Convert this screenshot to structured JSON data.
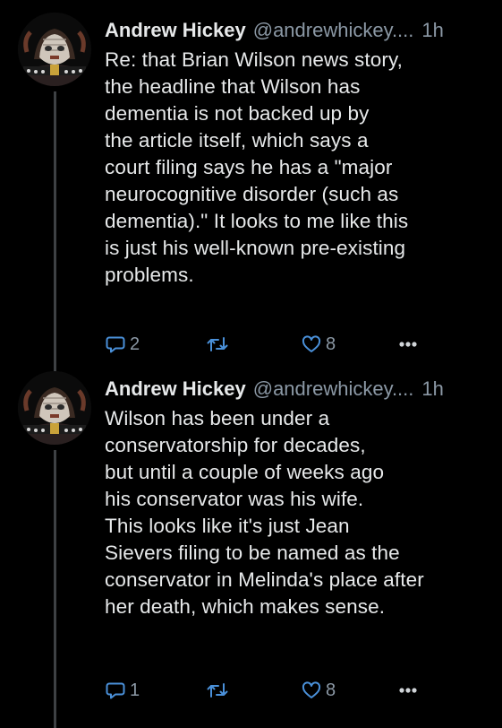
{
  "tweets": [
    {
      "author_name": "Andrew Hickey",
      "author_handle": "@andrewhickey....",
      "time": "1h",
      "text": "Re: that Brian Wilson news story,\nthe headline that Wilson has\ndementia is not backed up by\nthe article itself, which says a\ncourt filing says he has a \"major\nneurocognitive disorder (such as\ndementia).\" It looks to me like this\nis just his well-known pre-existing\nproblems.",
      "reply_count": "2",
      "retweet_count": "",
      "like_count": "8",
      "icons": [
        "avatar",
        "reply-icon",
        "retweet-icon",
        "like-icon",
        "more-icon"
      ]
    },
    {
      "author_name": "Andrew Hickey",
      "author_handle": "@andrewhickey....",
      "time": "1h",
      "text": "Wilson has been under a\nconservatorship for decades,\nbut until a couple of weeks ago\nhis conservator was his wife.\nThis looks like it's just Jean\nSievers filing to be named as the\nconservator in Melinda's place after\nher death, which makes sense.",
      "reply_count": "1",
      "retweet_count": "",
      "like_count": "8",
      "icons": [
        "avatar",
        "reply-icon",
        "retweet-icon",
        "like-icon",
        "more-icon"
      ]
    }
  ],
  "colors": {
    "background": "#000000",
    "text_primary": "#e7e9ea",
    "text_secondary": "#8b98a5",
    "thread_line": "#3e4144"
  }
}
